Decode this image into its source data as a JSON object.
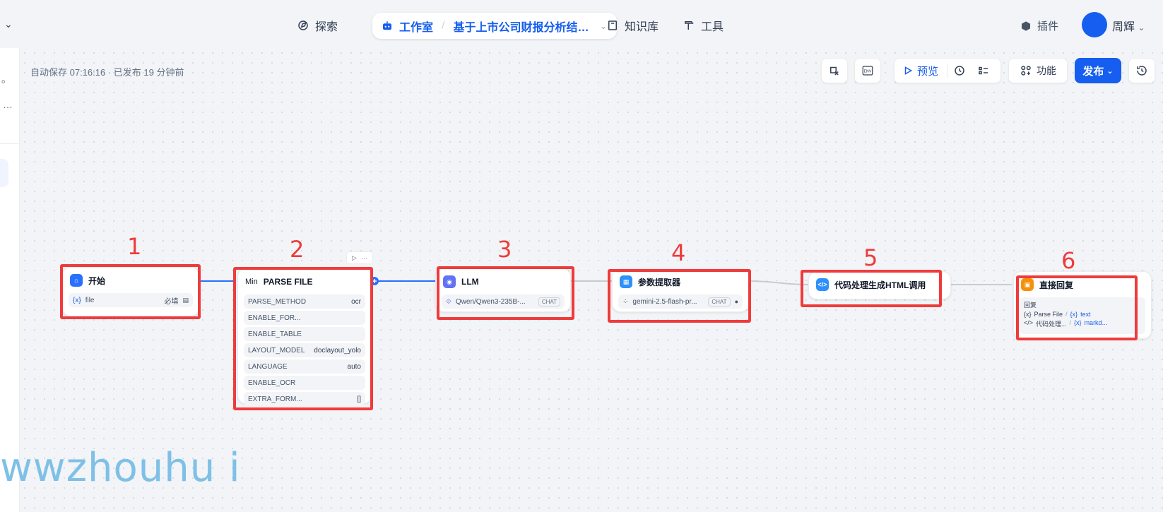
{
  "nav": {
    "explore": "探索",
    "studio": "工作室",
    "app_name": "基于上市公司财报分析结…",
    "knowledge": "知识库",
    "tools": "工具",
    "plugins": "插件",
    "username": "周辉"
  },
  "status": {
    "autosave": "自动保存 07:16:16 · 已发布 19 分钟前"
  },
  "toolbar": {
    "env": "ENV",
    "preview": "预览",
    "features": "功能",
    "publish": "发布"
  },
  "annotations": [
    "1",
    "2",
    "3",
    "4",
    "5",
    "6"
  ],
  "nodes": {
    "start": {
      "title": "开始",
      "var_icon": "{x}",
      "var_name": "file",
      "required": "必填"
    },
    "parse": {
      "prefix": "Min",
      "title": "PARSE FILE",
      "rows": [
        {
          "k": "PARSE_METHOD",
          "v": "ocr"
        },
        {
          "k": "ENABLE_FOR...",
          "v": ""
        },
        {
          "k": "ENABLE_TABLE",
          "v": ""
        },
        {
          "k": "LAYOUT_MODEL",
          "v": "doclayout_yolo"
        },
        {
          "k": "LANGUAGE",
          "v": "auto"
        },
        {
          "k": "ENABLE_OCR",
          "v": ""
        },
        {
          "k": "EXTRA_FORM...",
          "v": "[]"
        }
      ]
    },
    "llm": {
      "title": "LLM",
      "model": "Qwen/Qwen3-235B-...",
      "tag": "CHAT"
    },
    "extractor": {
      "title": "参数提取器",
      "model": "gemini-2.5-flash-pr...",
      "tag": "CHAT"
    },
    "code": {
      "title": "代码处理生成HTML调用"
    },
    "answer": {
      "title": "直接回复",
      "label": "回复",
      "line1_src": "Parse File",
      "line1_var": "text",
      "line2_src": "代码处理...",
      "line2_var": "markd..."
    }
  },
  "watermark": "wwzhouhu i",
  "colors": {
    "accent": "#155eef",
    "annotation": "#ef3b3b"
  }
}
